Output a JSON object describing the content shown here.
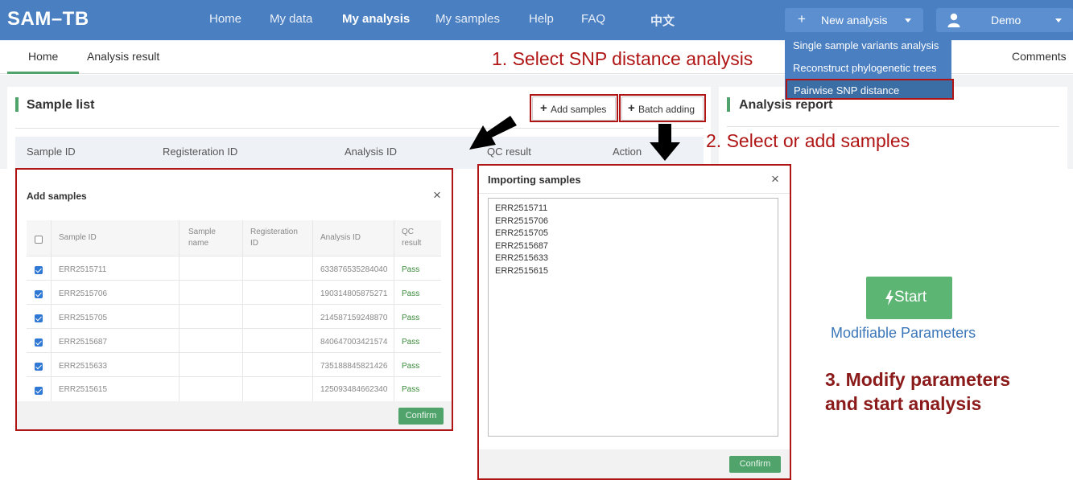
{
  "navbar": {
    "brand": "SAM–TB",
    "links": [
      "Home",
      "My data",
      "My analysis",
      "My samples",
      "Help",
      "FAQ",
      "中文"
    ],
    "new_analysis": {
      "plus": "+",
      "label": "New analysis"
    },
    "user": "Demo",
    "dropdown": [
      "Single sample variants analysis",
      "Reconstruct phylogenetic trees",
      "Pairwise SNP distance"
    ]
  },
  "tabs": [
    "Home",
    "Analysis result"
  ],
  "comments": "Comments",
  "annotations": {
    "step1": "1. Select SNP distance analysis",
    "step2": "2. Select or add samples",
    "step3_line1": "3. Modify parameters",
    "step3_line2": "and start analysis"
  },
  "sample_list": {
    "title": "Sample list",
    "add_button": "Add samples",
    "batch_button": "Batch adding",
    "button_plus": "+",
    "columns": [
      "Sample ID",
      "Registeration ID",
      "Analysis ID",
      "QC result",
      "Action"
    ]
  },
  "analysis_report": {
    "title": "Analysis report"
  },
  "add_modal": {
    "title": "Add samples",
    "close": "×",
    "columns": {
      "sample_id": "Sample ID",
      "sample_name": [
        "Sample",
        "name"
      ],
      "reg_id": [
        "Registeration",
        "ID"
      ],
      "analysis_id": "Analysis ID",
      "qc": [
        "QC",
        "result"
      ]
    },
    "rows": [
      {
        "sample_id": "ERR2515711",
        "analysis_id": "633876535284040",
        "qc": "Pass",
        "checked": true
      },
      {
        "sample_id": "ERR2515706",
        "analysis_id": "190314805875271",
        "qc": "Pass",
        "checked": true
      },
      {
        "sample_id": "ERR2515705",
        "analysis_id": "214587159248870",
        "qc": "Pass",
        "checked": true
      },
      {
        "sample_id": "ERR2515687",
        "analysis_id": "840647003421574",
        "qc": "Pass",
        "checked": true
      },
      {
        "sample_id": "ERR2515633",
        "analysis_id": "735188845821426",
        "qc": "Pass",
        "checked": true
      },
      {
        "sample_id": "ERR2515615",
        "analysis_id": "125093484662340",
        "qc": "Pass",
        "checked": true
      }
    ],
    "confirm": "Confirm"
  },
  "import_modal": {
    "title": "Importing samples",
    "close": "×",
    "text": "ERR2515711\nERR2515706\nERR2515705\nERR2515687\nERR2515633\nERR2515615",
    "confirm": "Confirm"
  },
  "start": {
    "label": "Start",
    "params_link": "Modifiable Parameters"
  },
  "colors": {
    "navbar": "#4a7fc1",
    "accent_green": "#4fa36b",
    "annotation_red": "#b01515",
    "link_blue": "#3b77b8"
  }
}
